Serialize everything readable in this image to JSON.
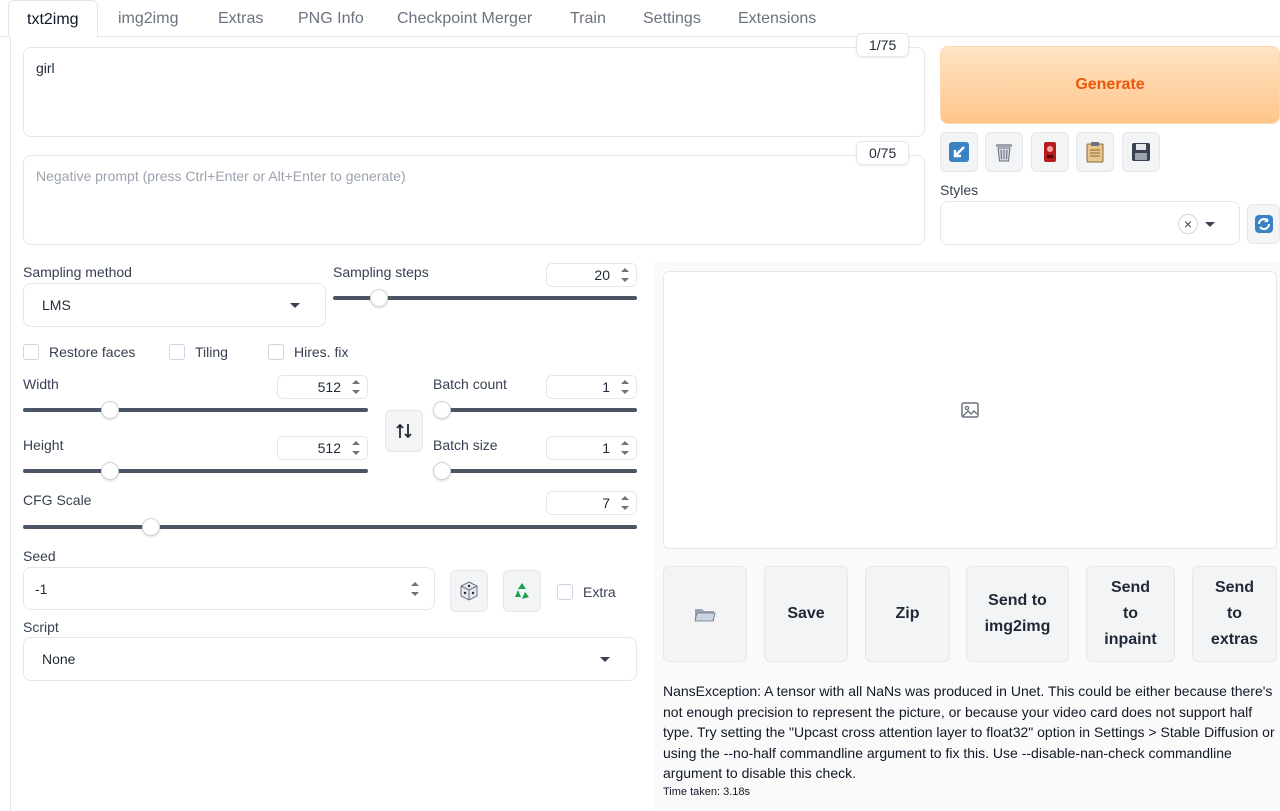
{
  "tabs": [
    "txt2img",
    "img2img",
    "Extras",
    "PNG Info",
    "Checkpoint Merger",
    "Train",
    "Settings",
    "Extensions"
  ],
  "prompt": {
    "value": "girl",
    "counter": "1/75"
  },
  "negative_prompt": {
    "placeholder": "Negative prompt (press Ctrl+Enter or Alt+Enter to generate)",
    "counter": "0/75"
  },
  "generate_label": "Generate",
  "styles": {
    "label": "Styles",
    "value": "",
    "clear_glyph": "×"
  },
  "sampling": {
    "method_label": "Sampling method",
    "method_value": "LMS",
    "steps_label": "Sampling steps",
    "steps_value": "20",
    "steps_fraction": 0.13
  },
  "checkboxes": {
    "restore_faces": "Restore faces",
    "tiling": "Tiling",
    "hires_fix": "Hires. fix"
  },
  "width": {
    "label": "Width",
    "value": "512",
    "fraction": 0.24
  },
  "height": {
    "label": "Height",
    "value": "512",
    "fraction": 0.24
  },
  "batch_count": {
    "label": "Batch count",
    "value": "1",
    "fraction": 0.0
  },
  "batch_size": {
    "label": "Batch size",
    "value": "1",
    "fraction": 0.0
  },
  "cfg_scale": {
    "label": "CFG Scale",
    "value": "7",
    "fraction": 0.2
  },
  "seed": {
    "label": "Seed",
    "value": "-1",
    "extra_label": "Extra"
  },
  "script": {
    "label": "Script",
    "value": "None"
  },
  "actions": {
    "save": "Save",
    "zip": "Zip",
    "send_img2img_1": "Send to",
    "send_img2img_2": "img2img",
    "send_inpaint_1": "Send",
    "send_inpaint_2": "to",
    "send_inpaint_3": "inpaint",
    "send_extras_1": "Send",
    "send_extras_2": "to",
    "send_extras_3": "extras"
  },
  "message": "NansException: A tensor with all NaNs was produced in Unet. This could be either because there's not enough precision to represent the picture, or because your video card does not support half type. Try setting the \"Upcast cross attention layer to float32\" option in Settings > Stable Diffusion or using the --no-half commandline argument to fix this. Use --disable-nan-check commandline argument to disable this check.",
  "time_taken": "Time taken: 3.18s",
  "icons": {
    "tool_buttons": [
      "paste-arrow-icon",
      "trash-icon",
      "red-badge-icon",
      "clipboard-icon",
      "floppy-save-icon"
    ],
    "refresh": "refresh-icon",
    "swap": "swap-arrows-icon",
    "dice": "dice-icon",
    "recycle": "recycle-icon",
    "folder": "folder-icon",
    "image_placeholder": "image-icon"
  },
  "colors": {
    "generate_text": "#ea580c",
    "generate_bg": "#ffc58a",
    "track": "#4b5563"
  }
}
